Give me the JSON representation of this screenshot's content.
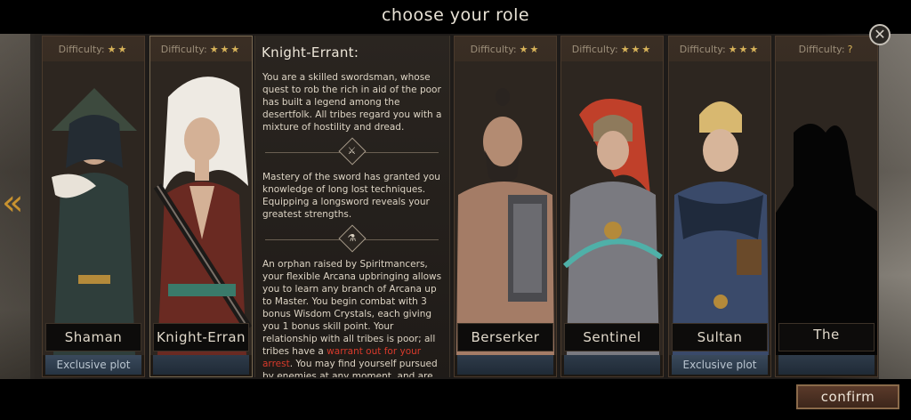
{
  "header": {
    "title": "choose your role"
  },
  "nav": {
    "prev_arrow": "«",
    "close": "✕"
  },
  "difficulty_label": "Difficulty:",
  "cards": [
    {
      "difficulty_stars": "★★",
      "name": "Shaman",
      "plot": "Exclusive plot"
    },
    {
      "difficulty_stars": "★★★",
      "name": "Knight-Erran",
      "plot": ""
    },
    {
      "difficulty_stars": "★★",
      "name": "Berserker",
      "plot": ""
    },
    {
      "difficulty_stars": "★★★",
      "name": "Sentinel",
      "plot": ""
    },
    {
      "difficulty_stars": "★★★",
      "name": "Sultan",
      "plot": "Exclusive plot"
    },
    {
      "difficulty_stars": "?",
      "name": "The",
      "plot": ""
    }
  ],
  "info": {
    "title": "Knight-Errant:",
    "p1": "You are a skilled swordsman, whose quest to rob the rich in aid of the poor has built a legend among the desertfolk. All tribes regard you with a mixture of hostility and dread.",
    "p2": "Mastery of the sword has granted you knowledge of long lost techniques. Equipping a longsword reveals your greatest strengths.",
    "p3_a": "An orphan raised by Spiritmancers, your flexible Arcana upbringing allows you to learn any branch of Arcana up to Master. You begin combat with 3 bonus Wisdom Crystals, each giving you 1 bonus skill point. Your relationship with all tribes is poor; all tribes have a ",
    "p3_red": "warrant out for your arrest",
    "p3_b": ". You may find yourself pursued by enemies at any moment, and are"
  },
  "footer": {
    "confirm_label": "confirm"
  },
  "colors": {
    "accent_gold": "#c8922f",
    "warning_red": "#d93a2b",
    "star": "#d9b45a"
  }
}
